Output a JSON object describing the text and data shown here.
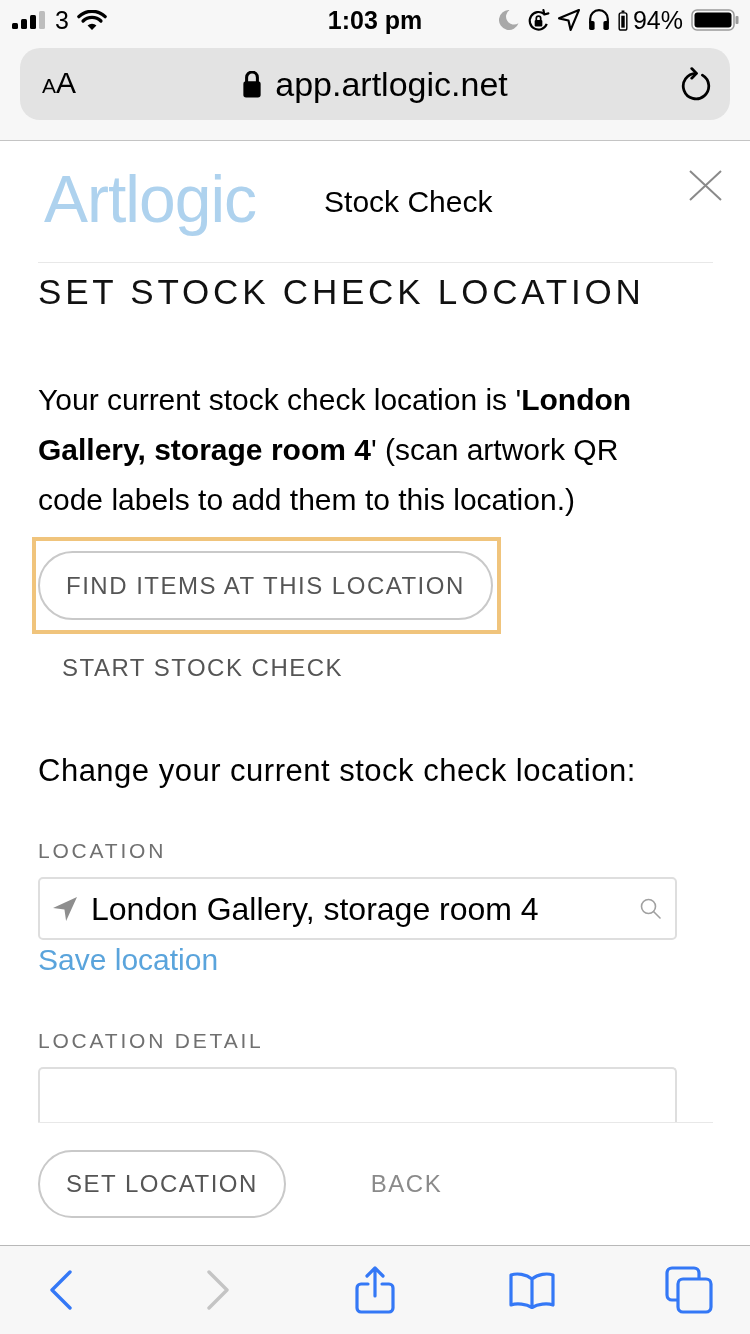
{
  "status_bar": {
    "carrier": "3",
    "time": "1:03 pm",
    "battery": "94%"
  },
  "browser": {
    "text_size": "AA",
    "url": "app.artlogic.net"
  },
  "header": {
    "logo": "Artlogic",
    "title": "Stock Check"
  },
  "page": {
    "heading": "SET STOCK CHECK LOCATION",
    "intro": "Your current stock check location is '**London Gallery, storage room 4**' (scan artwork QR code labels to add them to this location.)",
    "actions": [
      {
        "label": "FIND ITEMS AT THIS LOCATION",
        "kind": "outlined",
        "focused": true
      },
      {
        "label": "START STOCK CHECK",
        "kind": "text",
        "focused": false
      }
    ],
    "change_prompt": "Change your current stock check location:",
    "fields": [
      {
        "label": "LOCATION",
        "kind": "place-search",
        "value": "London Gallery, storage room 4",
        "link": "Save location"
      },
      {
        "label": "LOCATION DETAIL",
        "kind": "text"
      }
    ]
  },
  "footer": {
    "buttons": [
      {
        "label": "SET LOCATION",
        "kind": "outlined"
      },
      {
        "label": "BACK",
        "kind": "text"
      }
    ]
  },
  "toolbar": {
    "items": [
      {
        "kind": "back",
        "disabled": false
      },
      {
        "kind": "forward",
        "disabled": true
      },
      {
        "kind": "share",
        "disabled": false
      },
      {
        "kind": "bookmarks",
        "disabled": false
      },
      {
        "kind": "tabs",
        "disabled": false
      }
    ]
  }
}
